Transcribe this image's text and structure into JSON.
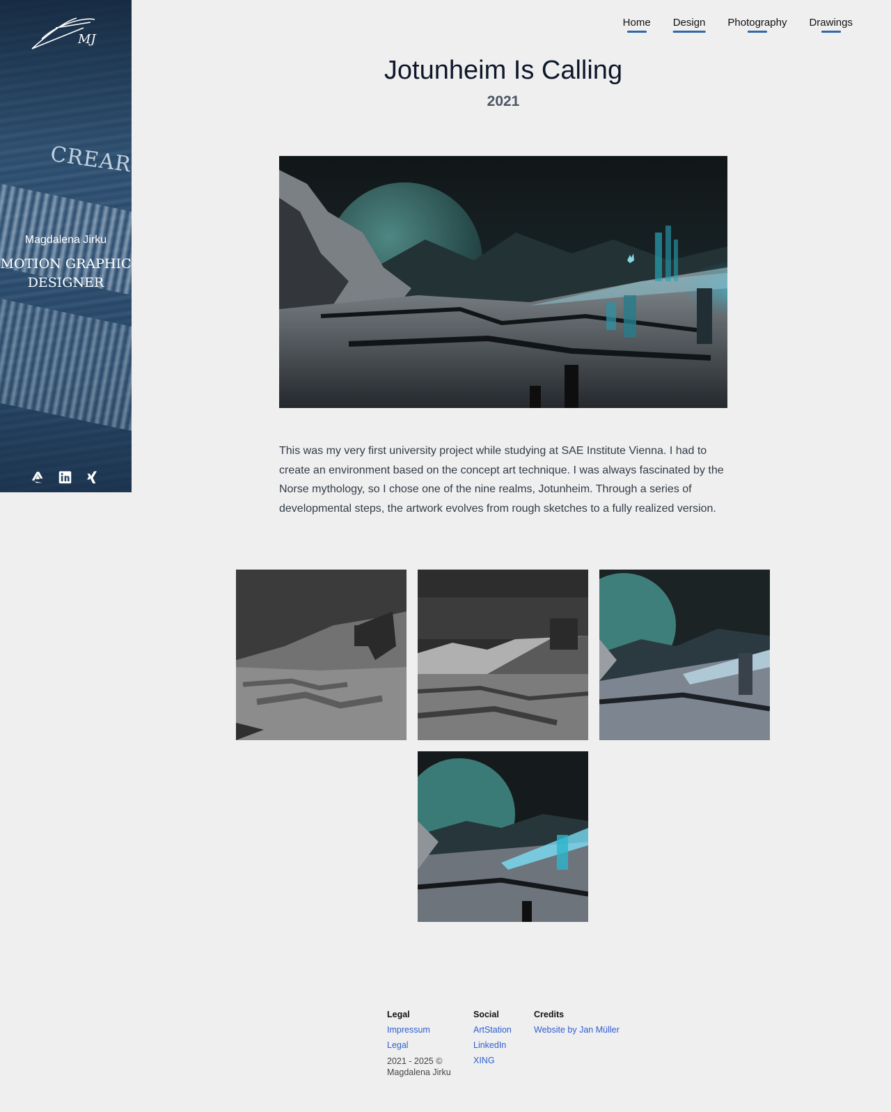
{
  "sidebar": {
    "name": "Magdalena Jirku",
    "role": "MOTION GRAPHIC DESIGNER",
    "backdrop_text": "CREARTI",
    "logo_initials": "MJ",
    "social_icons": [
      "artstation-icon",
      "linkedin-icon",
      "xing-icon"
    ]
  },
  "nav": {
    "items": [
      {
        "label": "Home"
      },
      {
        "label": "Design"
      },
      {
        "label": "Photography"
      },
      {
        "label": "Drawings"
      }
    ],
    "active": "Design",
    "accent": "#2f67a8"
  },
  "project": {
    "title": "Jotunheim Is Calling",
    "year": "2021",
    "description": "This was my very first university project while studying at SAE Institute Vienna. I had to create an environment based on the concept art technique. I was always fascinated by the Norse mythology, so I chose one of the nine realms, Jotunheim. Through a series of developmental steps, the artwork evolves from rough sketches to a fully realized version."
  },
  "footer": {
    "legal": {
      "heading": "Legal",
      "links": [
        "Impressum",
        "Legal"
      ],
      "copyright": "2021 - 2025 © Magdalena Jirku"
    },
    "social": {
      "heading": "Social",
      "links": [
        "ArtStation",
        "LinkedIn",
        "XING"
      ]
    },
    "credits": {
      "heading": "Credits",
      "links": [
        "Website by Jan Müller"
      ]
    },
    "link_color": "#2f5fd0"
  }
}
